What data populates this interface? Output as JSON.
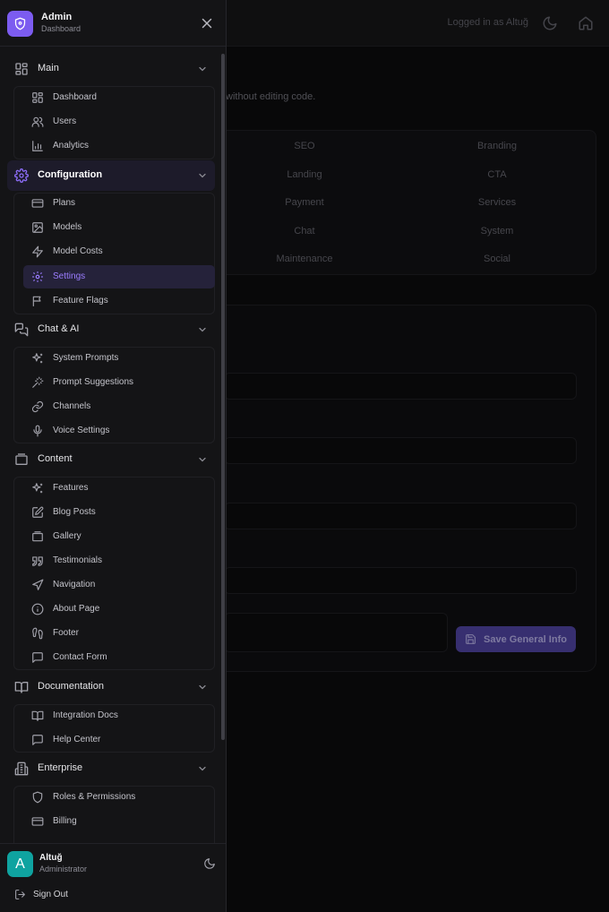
{
  "topbar": {
    "logged_in": "Logged in as Altuğ"
  },
  "background": {
    "description": "without editing code.",
    "tabs": [
      "SEO",
      "Branding",
      "Landing",
      "CTA",
      "Payment",
      "Services",
      "Chat",
      "System",
      "Maintenance",
      "Social"
    ],
    "save_label": "Save General Info"
  },
  "brand": {
    "title": "Admin",
    "subtitle": "Dashboard"
  },
  "sections": {
    "main": {
      "label": "Main",
      "icon": "layout-grid-icon",
      "items": [
        "Dashboard",
        "Users",
        "Analytics"
      ]
    },
    "configuration": {
      "label": "Configuration",
      "icon": "gear-icon",
      "items": [
        "Plans",
        "Models",
        "Model Costs",
        "Settings",
        "Feature Flags"
      ],
      "active_item": "Settings"
    },
    "chat": {
      "label": "Chat & AI",
      "icon": "chat-bubbles-icon",
      "items": [
        "System Prompts",
        "Prompt Suggestions",
        "Channels",
        "Voice Settings"
      ]
    },
    "content": {
      "label": "Content",
      "icon": "gallery-icon",
      "items": [
        "Features",
        "Blog Posts",
        "Gallery",
        "Testimonials",
        "Navigation",
        "About Page",
        "Footer",
        "Contact Form"
      ]
    },
    "documentation": {
      "label": "Documentation",
      "icon": "book-icon",
      "items": [
        "Integration Docs",
        "Help Center"
      ]
    },
    "enterprise": {
      "label": "Enterprise",
      "icon": "building-icon",
      "items": [
        "Roles & Permissions",
        "Billing"
      ]
    }
  },
  "user": {
    "initial": "A",
    "name": "Altuğ",
    "role": "Administrator"
  },
  "signout_label": "Sign Out",
  "colors": {
    "accent": "#7c5cf0",
    "active_text": "#9b7dff",
    "avatar": "#0fa3a0",
    "sidebar_bg": "#141416"
  }
}
